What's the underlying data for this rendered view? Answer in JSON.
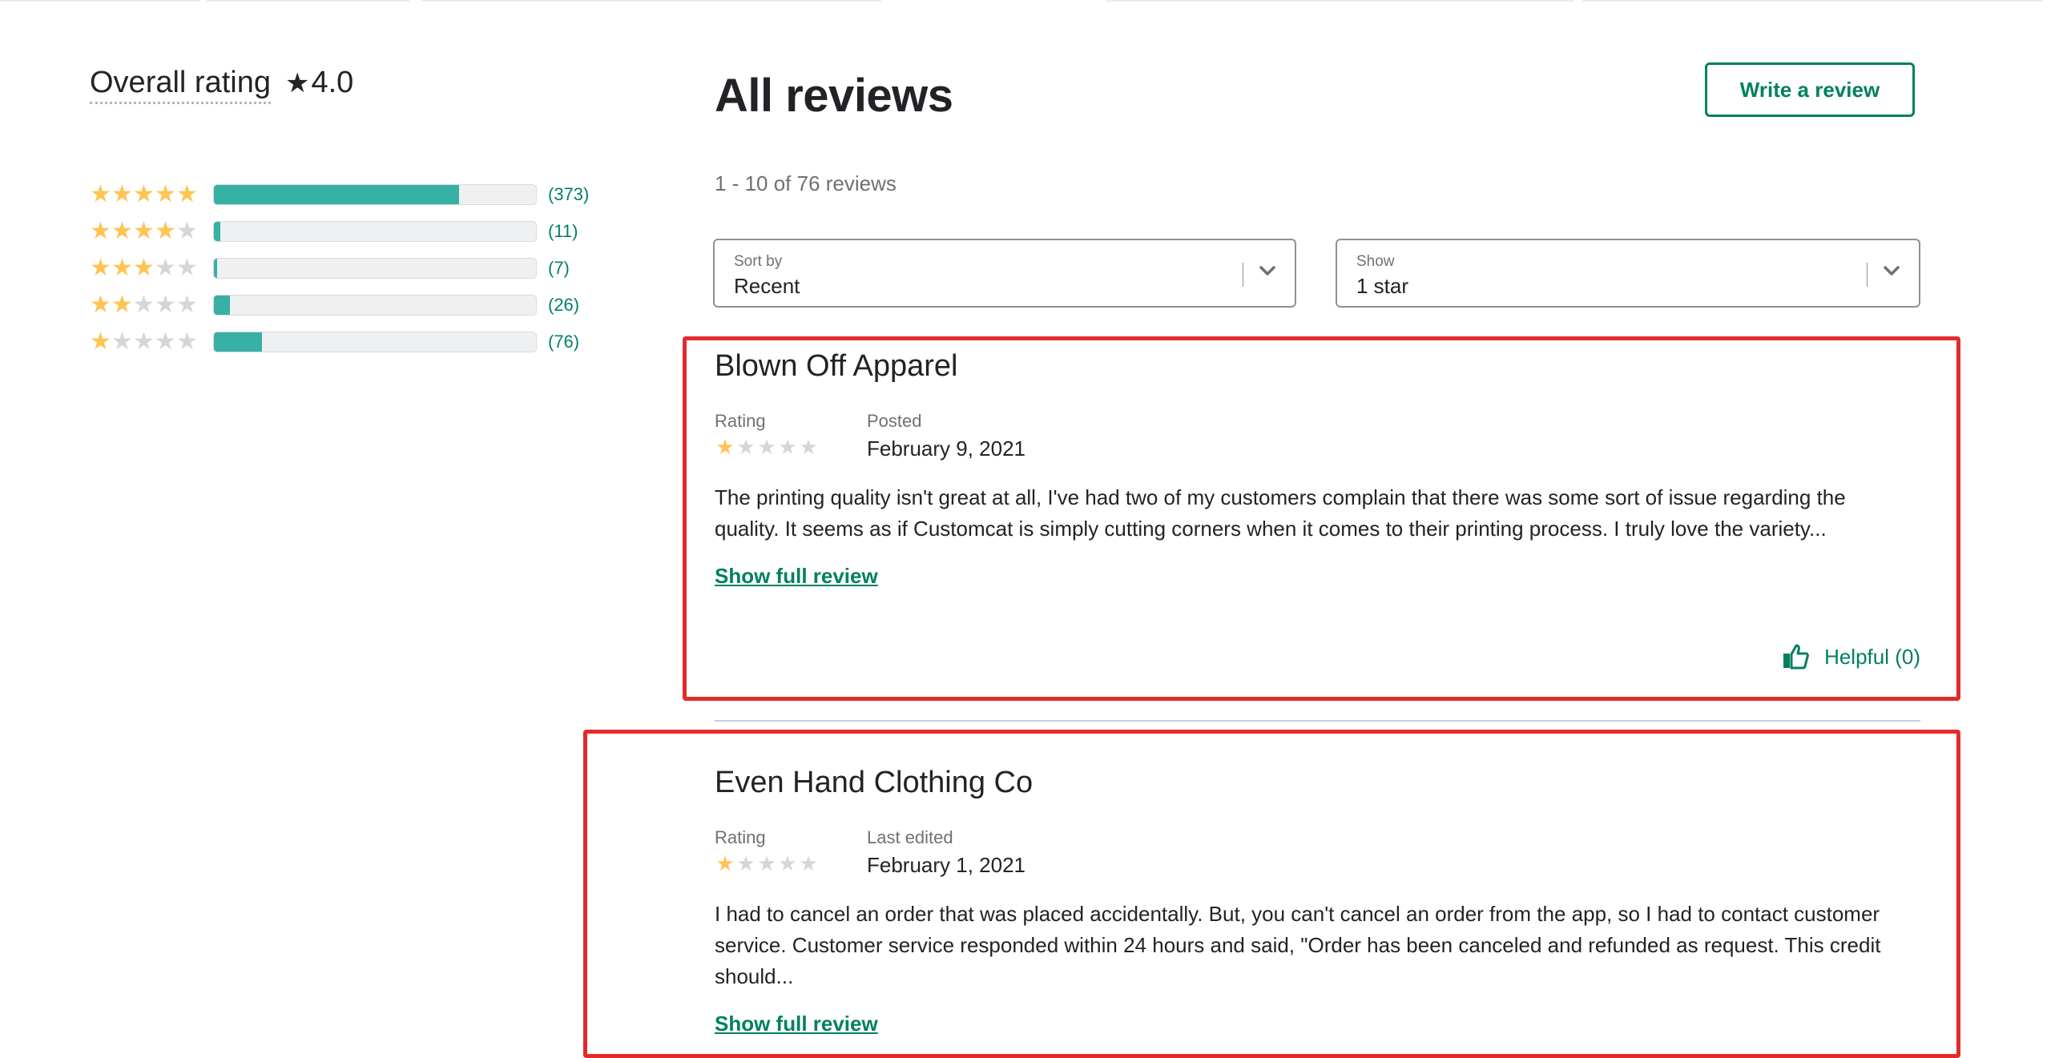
{
  "overall": {
    "label": "Overall rating",
    "star_icon": "★",
    "score": "4.0"
  },
  "distribution": [
    {
      "stars": 5,
      "count_label": "(373)",
      "count": 373,
      "fill_fraction": 0.76
    },
    {
      "stars": 4,
      "count_label": "(11)",
      "count": 11,
      "fill_fraction": 0.02
    },
    {
      "stars": 3,
      "count_label": "(7)",
      "count": 7,
      "fill_fraction": 0.01
    },
    {
      "stars": 2,
      "count_label": "(26)",
      "count": 26,
      "fill_fraction": 0.05
    },
    {
      "stars": 1,
      "count_label": "(76)",
      "count": 76,
      "fill_fraction": 0.15
    }
  ],
  "main": {
    "title": "All reviews",
    "write_review_label": "Write a review",
    "count_text": "1 - 10 of 76 reviews",
    "sort": {
      "label": "Sort by",
      "value": "Recent"
    },
    "show": {
      "label": "Show",
      "value": "1 star"
    }
  },
  "reviews": [
    {
      "name": "Blown Off Apparel",
      "rating_label": "Rating",
      "rating": 1,
      "date_label": "Posted",
      "date": "February 9, 2021",
      "body": "The printing quality isn't great at all, I've had two of my customers complain that there was some sort of issue regarding the quality. It seems as if Customcat is simply cutting corners when it comes to their printing process. I truly love the variety...",
      "show_full_label": "Show full review",
      "helpful_label": "Helpful (0)"
    },
    {
      "name": "Even Hand Clothing Co",
      "rating_label": "Rating",
      "rating": 1,
      "date_label": "Last edited",
      "date": "February 1, 2021",
      "body": "I had to cancel an order that was placed accidentally. But, you can't cancel an order from the app, so I had to contact customer service. Customer service responded within 24 hours and said, \"Order has been canceled and refunded as request. This credit should...",
      "show_full_label": "Show full review"
    }
  ],
  "colors": {
    "accent": "#008060",
    "bar_fill": "#37b0a6",
    "star_on": "#ffc453",
    "star_off": "#d4d6da",
    "highlight_box": "#e32b2b"
  }
}
